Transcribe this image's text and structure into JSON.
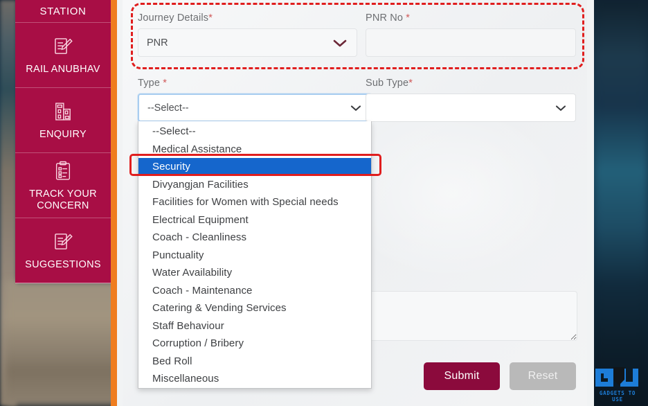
{
  "sidebar": {
    "top_label": "STATION",
    "items": [
      {
        "label": "RAIL ANUBHAV",
        "icon": "note-pencil-icon"
      },
      {
        "label": "ENQUIRY",
        "icon": "station-building-icon"
      },
      {
        "label": "TRACK YOUR CONCERN",
        "icon": "clipboard-check-icon"
      },
      {
        "label": "SUGGESTIONS",
        "icon": "note-pencil-icon"
      }
    ],
    "color": "#a80e45",
    "accent_bar_color": "#ef7d1f"
  },
  "form": {
    "journey_details": {
      "label": "Journey Details",
      "required_mark": "*",
      "value": "PNR",
      "chevron_icon": "chevron-down-icon"
    },
    "pnr_no": {
      "label": "PNR No ",
      "required_mark": "*",
      "value": "",
      "placeholder": ""
    },
    "type": {
      "label": "Type ",
      "required_mark": "*",
      "value": "--Select--",
      "chevron_icon": "chevron-down-icon",
      "expanded": true,
      "selected_option": "Security",
      "options": [
        "--Select--",
        "Medical Assistance",
        "Security",
        "Divyangjan Facilities",
        "Facilities for Women with Special needs",
        "Electrical Equipment",
        "Coach - Cleanliness",
        "Punctuality",
        "Water Availability",
        "Coach - Maintenance",
        "Catering & Vending Services",
        "Staff Behaviour",
        "Corruption / Bribery",
        "Bed Roll",
        "Miscellaneous"
      ]
    },
    "sub_type": {
      "label": "Sub Type",
      "required_mark": "*",
      "value": "",
      "chevron_icon": "chevron-down-icon"
    },
    "description": {
      "value": "",
      "placeholder": ""
    }
  },
  "buttons": {
    "submit": "Submit",
    "reset": "Reset",
    "submit_color": "#8b0a3c",
    "reset_color": "#b9b9b9"
  },
  "annotations": {
    "highlight_color": "#e01e1e",
    "selected_option_bg": "#1566cc"
  },
  "watermark": {
    "text": "GADGETS TO USE",
    "mark": "GU"
  }
}
